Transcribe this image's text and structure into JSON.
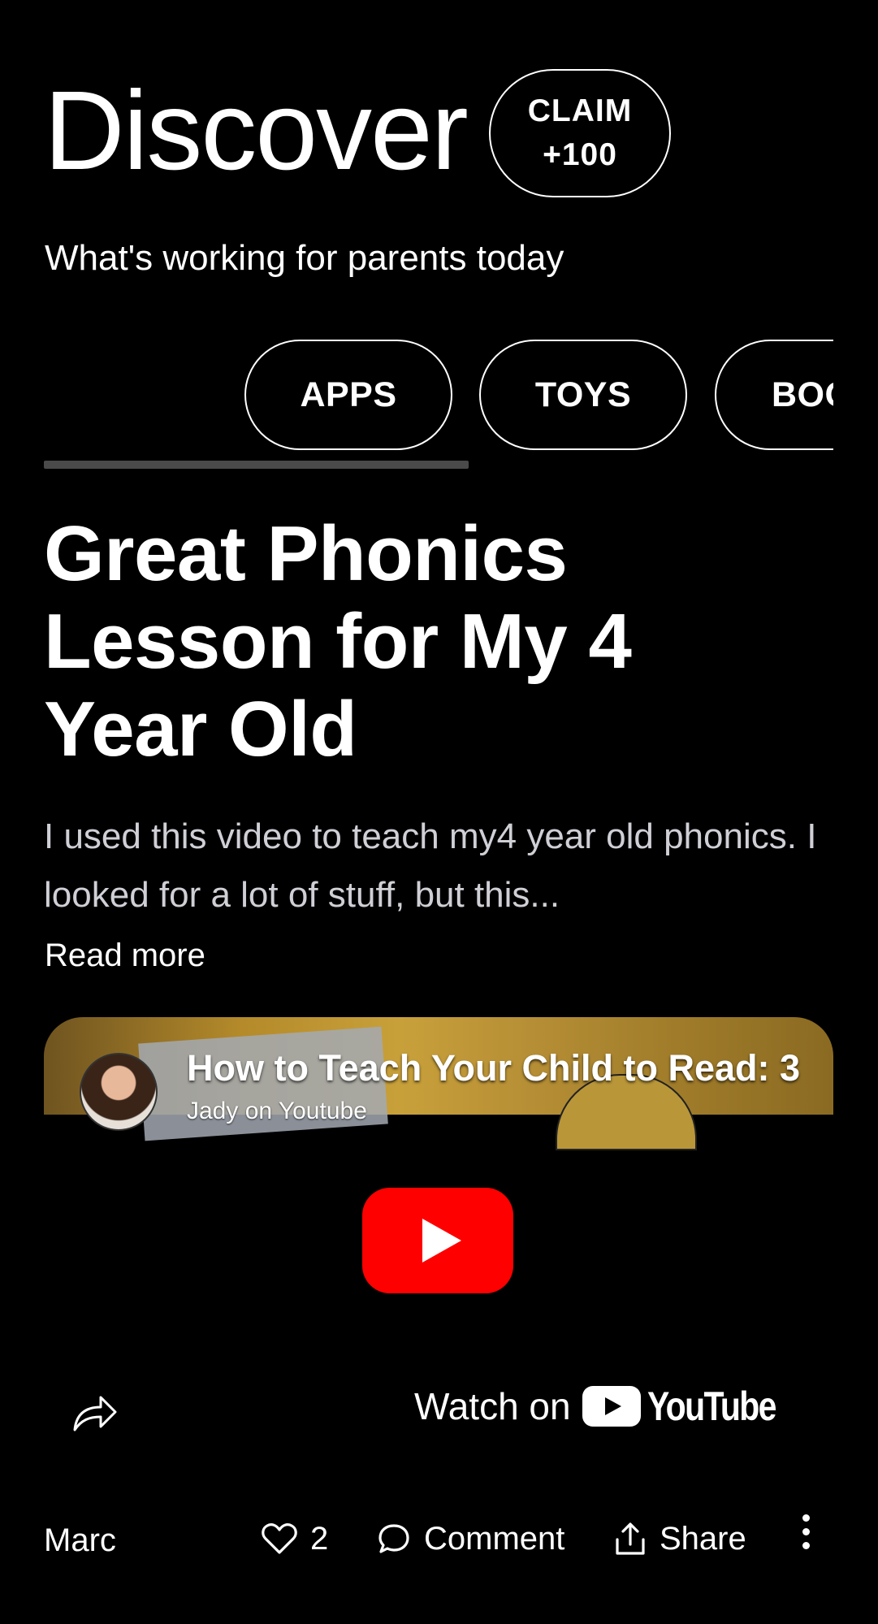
{
  "header": {
    "title": "Discover",
    "claim_line1": "CLAIM",
    "claim_line2": "+100",
    "subtitle": "What's working for parents today"
  },
  "categories": {
    "items": [
      {
        "label": "APPS"
      },
      {
        "label": "TOYS"
      },
      {
        "label": "BOOKS"
      }
    ],
    "scroll_progress": 0.54
  },
  "post": {
    "title": "Great Phonics Lesson for My 4 Year Old",
    "body": "I used this video to teach my4 year old phonics. I looked for a lot of stuff, but this...",
    "read_more": "Read more",
    "author": "Marc",
    "likes": "2",
    "comment_label": "Comment",
    "share_label": "Share"
  },
  "video": {
    "title": "How to Teach Your Child to Read: 3",
    "channel": "Jady on Youtube",
    "watch_on": "Watch on",
    "youtube_wordmark": "YouTube",
    "play_color": "#ff0000"
  }
}
